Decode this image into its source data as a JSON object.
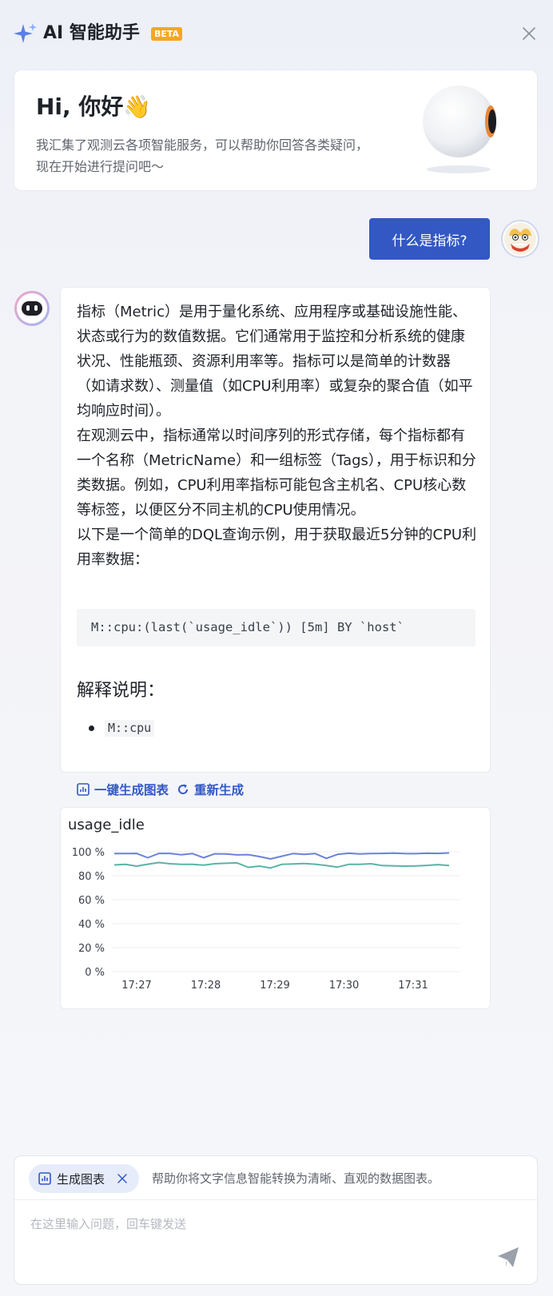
{
  "header": {
    "title": "AI 智能助手",
    "badge": "BETA"
  },
  "greeting": {
    "title": "Hi, 你好👋",
    "description": "我汇集了观测云各项智能服务，可以帮助你回答各类疑问，现在开始进行提问吧～"
  },
  "conversation": {
    "user_question": "什么是指标?",
    "answer_paragraphs": [
      "指标（Metric）是用于量化系统、应用程序或基础设施性能、状态或行为的数值数据。它们通常用于监控和分析系统的健康状况、性能瓶颈、资源利用率等。指标可以是简单的计数器（如请求数）、测量值（如CPU利用率）或复杂的聚合值（如平均响应时间）。",
      "在观测云中，指标通常以时间序列的形式存储，每个指标都有一个名称（MetricName）和一组标签（Tags），用于标识和分类数据。例如，CPU利用率指标可能包含主机名、CPU核心数等标签，以便区分不同主机的CPU使用情况。",
      "以下是一个简单的DQL查询示例，用于获取最近5分钟的CPU利用率数据："
    ],
    "code": "M::cpu:(last(`usage_idle`)) [5m] BY `host`",
    "explain_title": "解释说明：",
    "explain_items": [
      "M::cpu"
    ]
  },
  "actions": {
    "generate_chart": "一键生成图表",
    "regenerate": "重新生成"
  },
  "chart_data": {
    "type": "line",
    "title": "usage_idle",
    "x_ticks": [
      "17:27",
      "17:28",
      "17:29",
      "17:30",
      "17:31"
    ],
    "y_ticks": [
      "100 %",
      "80 %",
      "60 %",
      "40 %",
      "20 %",
      "0 %"
    ],
    "ylim": [
      0,
      100
    ],
    "grid": true,
    "series": [
      {
        "color": "#6b82d8",
        "values": [
          98.5,
          98.5,
          98.6,
          95,
          98.6,
          98.6,
          97.5,
          98.5,
          95,
          98.3,
          98.2,
          97.4,
          97.6,
          96,
          94,
          96.3,
          98.5,
          97.8,
          98.5,
          94.5,
          97.8,
          98.7,
          98.2,
          98.5,
          98.6,
          98.8,
          98.5,
          98.4,
          98.7,
          98.6,
          99
        ]
      },
      {
        "color": "#5ab3a8",
        "values": [
          89,
          89.5,
          88,
          89.6,
          91,
          90,
          89.5,
          89.5,
          88.8,
          90,
          90.4,
          90.7,
          87,
          88,
          86.5,
          89.5,
          89.8,
          90.2,
          89.6,
          88.5,
          87.2,
          89.5,
          89.5,
          90,
          88.5,
          88.3,
          88,
          88.2,
          88.6,
          89.3,
          88.5
        ]
      }
    ]
  },
  "input": {
    "tag_label": "生成图表",
    "tag_hint": "帮助你将文字信息智能转换为清晰、直观的数据图表。",
    "placeholder": "在这里输入问题，回车键发送"
  },
  "colors": {
    "accent": "#3358c4",
    "badge": "#f5a623"
  }
}
